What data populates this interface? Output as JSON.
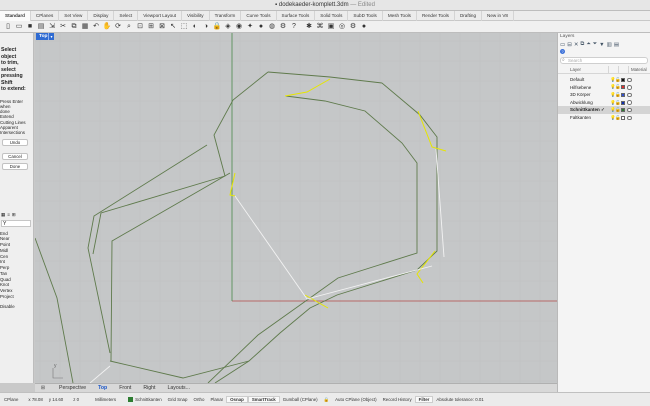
{
  "window": {
    "doc_icon": "document-icon",
    "title": "dodekaeder-komplett.3dm",
    "status": "— Edited"
  },
  "tabs": [
    "Standard",
    "CPlanes",
    "Set View",
    "Display",
    "Select",
    "Viewport Layout",
    "Visibility",
    "Transform",
    "Curve Tools",
    "Surface Tools",
    "Solid Tools",
    "SubD Tools",
    "Mesh Tools",
    "Render Tools",
    "Drafting",
    "New in V8"
  ],
  "command": {
    "title_lines": [
      "Select object",
      "to trim, select",
      "pressing Shift",
      "to extend:"
    ],
    "hint_lines": [
      "Press Enter when",
      "done",
      "Extend",
      "Cutting Lines",
      "Apparent",
      "Intersections"
    ],
    "undo_label": "Undo",
    "cancel_label": "Cancel",
    "done_label": "Done",
    "filter_glyph": "Y",
    "osnaps": [
      "End",
      "Near",
      "Point",
      "Midl",
      "Cen",
      "Int",
      "Perp",
      "Tan",
      "Quad",
      "Knot",
      "Vertex",
      "Project",
      "Disable"
    ]
  },
  "viewport": {
    "label": "Top",
    "menu_glyph": "▾",
    "axis_label": "y",
    "geometry_color": "#5f7a4c",
    "selection_color": "#e6e600",
    "highlight_color": "#f2f2f2",
    "xaxis_color": "#b44a4a",
    "yaxis_color": "#4c8a4c"
  },
  "view_tabs": {
    "icon": "grid-icon",
    "items": [
      "Perspective",
      "Top",
      "Front",
      "Right",
      "Layouts..."
    ],
    "active": "Top"
  },
  "layers_panel": {
    "title": "Layers",
    "search_placeholder": "Search",
    "col_layer": "Layer",
    "col_material": "Material",
    "rows": [
      {
        "name": "Default",
        "color": "#111111",
        "current": false
      },
      {
        "name": "Hilfsebene",
        "color": "#e03030",
        "current": false
      },
      {
        "name": "3D Körper",
        "color": "#3050d0",
        "current": false
      },
      {
        "name": "Abwicklung",
        "color": "#1030b0",
        "current": false
      },
      {
        "name": "Schnittkanten ✓",
        "color": "#2e7d32",
        "current": true
      },
      {
        "name": "Faltkanten",
        "color": "#ffffff",
        "current": false
      }
    ]
  },
  "status": {
    "cplane": "CPlane",
    "x": "x 78.08",
    "y": "y 14.60",
    "z": "z 0",
    "units": "Millimeters",
    "layer": "Schnittkanten",
    "layer_color": "#2e7d32",
    "toggles": [
      "Grid Snap",
      "Ortho",
      "Planar",
      "Osnap",
      "SmartTrack",
      "Gumball (CPlane)",
      "Auto CPlane (Object)",
      "Record History",
      "Filter"
    ],
    "bold_toggles": [
      "Osnap",
      "SmartTrack",
      "Filter"
    ],
    "tolerance": "Absolute tolerance: 0.01"
  }
}
